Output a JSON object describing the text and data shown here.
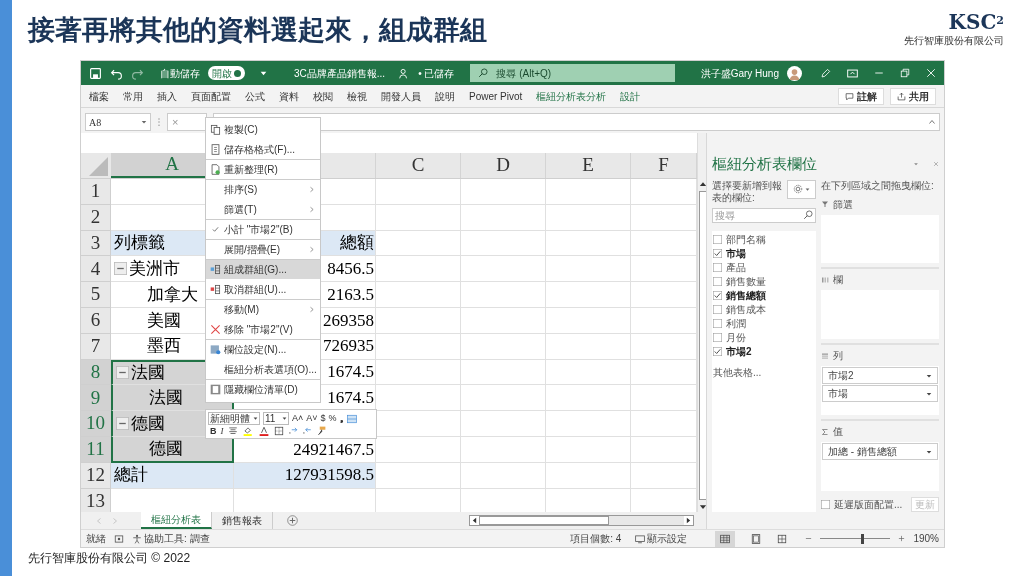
{
  "slide": {
    "title": "接著再將其他的資料選起來，組成群組",
    "logo": "KSC",
    "logo_sup": "2",
    "company": "先行智庫股份有限公司",
    "footer": "先行智庫股份有限公司 © 2022"
  },
  "title_bar": {
    "autosave_label": "自動儲存",
    "autosave": {
      "label": "開啟",
      "on": true
    },
    "file_name": "3C品牌產品銷售報...",
    "save_state": "• 已儲存",
    "search_placeholder": "搜尋 (Alt+Q)",
    "user": "洪子盛Gary Hung"
  },
  "ribbon_tabs": [
    {
      "label": "檔案",
      "kind": "normal"
    },
    {
      "label": "常用",
      "kind": "normal"
    },
    {
      "label": "插入",
      "kind": "normal"
    },
    {
      "label": "頁面配置",
      "kind": "normal"
    },
    {
      "label": "公式",
      "kind": "normal"
    },
    {
      "label": "資料",
      "kind": "normal"
    },
    {
      "label": "校閱",
      "kind": "normal"
    },
    {
      "label": "檢視",
      "kind": "normal"
    },
    {
      "label": "開發人員",
      "kind": "normal"
    },
    {
      "label": "說明",
      "kind": "normal"
    },
    {
      "label": "Power Pivot",
      "kind": "normal"
    },
    {
      "label": "樞紐分析表分析",
      "kind": "contextual"
    },
    {
      "label": "設計",
      "kind": "contextual"
    }
  ],
  "ribbon_buttons": [
    "註解",
    "共用"
  ],
  "formula_bar": {
    "name_box": "A8",
    "cancel": "×"
  },
  "columns": [
    {
      "label": "A",
      "selected": true
    },
    {
      "selected": false
    },
    {
      "label": "C",
      "selected": false
    },
    {
      "label": "D",
      "selected": false
    },
    {
      "label": "E",
      "selected": false
    },
    {
      "label": "F",
      "selected": false
    }
  ],
  "rows": [
    {
      "n": "1",
      "kind": "blank",
      "selected": false
    },
    {
      "n": "2",
      "kind": "blank",
      "selected": false
    },
    {
      "n": "3",
      "kind": "header",
      "a": "列標籤",
      "b": "總額",
      "selected": false
    },
    {
      "n": "4",
      "kind": "group",
      "a": "美洲市",
      "b": "8456.5",
      "selected": false
    },
    {
      "n": "5",
      "kind": "item",
      "a": "加拿大",
      "b": "2163.5",
      "selected": false
    },
    {
      "n": "6",
      "kind": "item",
      "a": "美國",
      "b": "269358",
      "selected": false
    },
    {
      "n": "7",
      "kind": "item",
      "a": "墨西",
      "b": "726935",
      "selected": false
    },
    {
      "n": "8",
      "kind": "group",
      "a": "法國",
      "b": "1674.5",
      "selected": true
    },
    {
      "n": "9",
      "kind": "item",
      "a": "法國",
      "b": "1674.5",
      "selected": true
    },
    {
      "n": "10",
      "kind": "group",
      "a": "德國",
      "selected": true
    },
    {
      "n": "11",
      "kind": "item",
      "a": "德國",
      "b": "24921467.5",
      "selected": true
    },
    {
      "n": "12",
      "kind": "total",
      "a": "總計",
      "b": "127931598.5",
      "selected": false
    },
    {
      "n": "13",
      "kind": "blank",
      "selected": false
    }
  ],
  "context_menu": [
    {
      "label": "複製(C)",
      "kind": "copy",
      "highlighted": false,
      "submenu": false,
      "divider_after": false
    },
    {
      "label": "儲存格格式(F)...",
      "kind": "format",
      "highlighted": false,
      "submenu": false,
      "divider_after": true
    },
    {
      "label": "重新整理(R)",
      "kind": "refresh",
      "highlighted": false,
      "submenu": false,
      "divider_after": true
    },
    {
      "label": "排序(S)",
      "kind": "plain",
      "highlighted": false,
      "submenu": true,
      "divider_after": false
    },
    {
      "label": "篩選(T)",
      "kind": "plain",
      "highlighted": false,
      "submenu": true,
      "divider_after": true
    },
    {
      "label": "小計 \"市場2\"(B)",
      "kind": "check",
      "checked": true,
      "highlighted": false,
      "submenu": false,
      "divider_after": true
    },
    {
      "label": "展開/摺疊(E)",
      "kind": "plain",
      "highlighted": false,
      "submenu": true,
      "divider_after": true
    },
    {
      "label": "組成群組(G)...",
      "kind": "group",
      "highlighted": true,
      "submenu": false,
      "divider_after": false
    },
    {
      "label": "取消群組(U)...",
      "kind": "ungroup",
      "highlighted": false,
      "submenu": false,
      "divider_after": true
    },
    {
      "label": "移動(M)",
      "kind": "plain",
      "highlighted": false,
      "submenu": true,
      "divider_after": false
    },
    {
      "label": "移除 \"市場2\"(V)",
      "kind": "remove",
      "highlighted": false,
      "submenu": false,
      "divider_after": true
    },
    {
      "label": "欄位設定(N)...",
      "kind": "settings",
      "highlighted": false,
      "submenu": false,
      "divider_after": false
    },
    {
      "label": "樞紐分析表選項(O)...",
      "kind": "plain",
      "highlighted": false,
      "submenu": false,
      "divider_after": true
    },
    {
      "label": "隱藏欄位清單(D)",
      "kind": "hide",
      "highlighted": false,
      "submenu": false,
      "divider_after": false
    }
  ],
  "mini_toolbar": {
    "font": "新細明體",
    "size": "11",
    "glyphs": [
      "A˄",
      "A˅",
      "$",
      "%",
      "❟"
    ],
    "style_glyphs": [
      "B",
      "I"
    ]
  },
  "sheet_tabs": [
    {
      "label": "樞紐分析表",
      "selected": true
    },
    {
      "label": "銷售報表",
      "selected": false
    }
  ],
  "pivot_pane": {
    "title": "樞紐分析表欄位",
    "choose_label": "選擇要新增到報表的欄位:",
    "search_placeholder": "搜尋",
    "fields": [
      {
        "label": "部門名稱",
        "checked": false
      },
      {
        "label": "市場",
        "checked": true
      },
      {
        "label": "產品",
        "checked": false
      },
      {
        "label": "銷售數量",
        "checked": false
      },
      {
        "label": "銷售總額",
        "checked": true
      },
      {
        "label": "銷售成本",
        "checked": false
      },
      {
        "label": "利潤",
        "checked": false
      },
      {
        "label": "月份",
        "checked": false
      },
      {
        "label": "市場2",
        "checked": true
      }
    ],
    "more_tables": "其他表格...",
    "drag_label": "在下列區域之間拖曳欄位:",
    "areas": [
      {
        "kind": "filter",
        "label": "篩選"
      },
      {
        "kind": "columns",
        "label": "欄"
      },
      {
        "kind": "rows",
        "label": "列",
        "items": [
          "市場2",
          "市場"
        ]
      },
      {
        "kind": "values",
        "label": "值",
        "items": [
          "加總 - 銷售總額"
        ]
      }
    ],
    "defer_label": "延遲版面配置...",
    "defer": false,
    "update": "更新"
  },
  "status_bar": {
    "zoom_slider": {
      "level": 0.6
    },
    "ready": "就緒",
    "accessibility": "協助工具: 調查",
    "count": "項目個數: 4",
    "display": "顯示設定",
    "zoom": "190%"
  }
}
